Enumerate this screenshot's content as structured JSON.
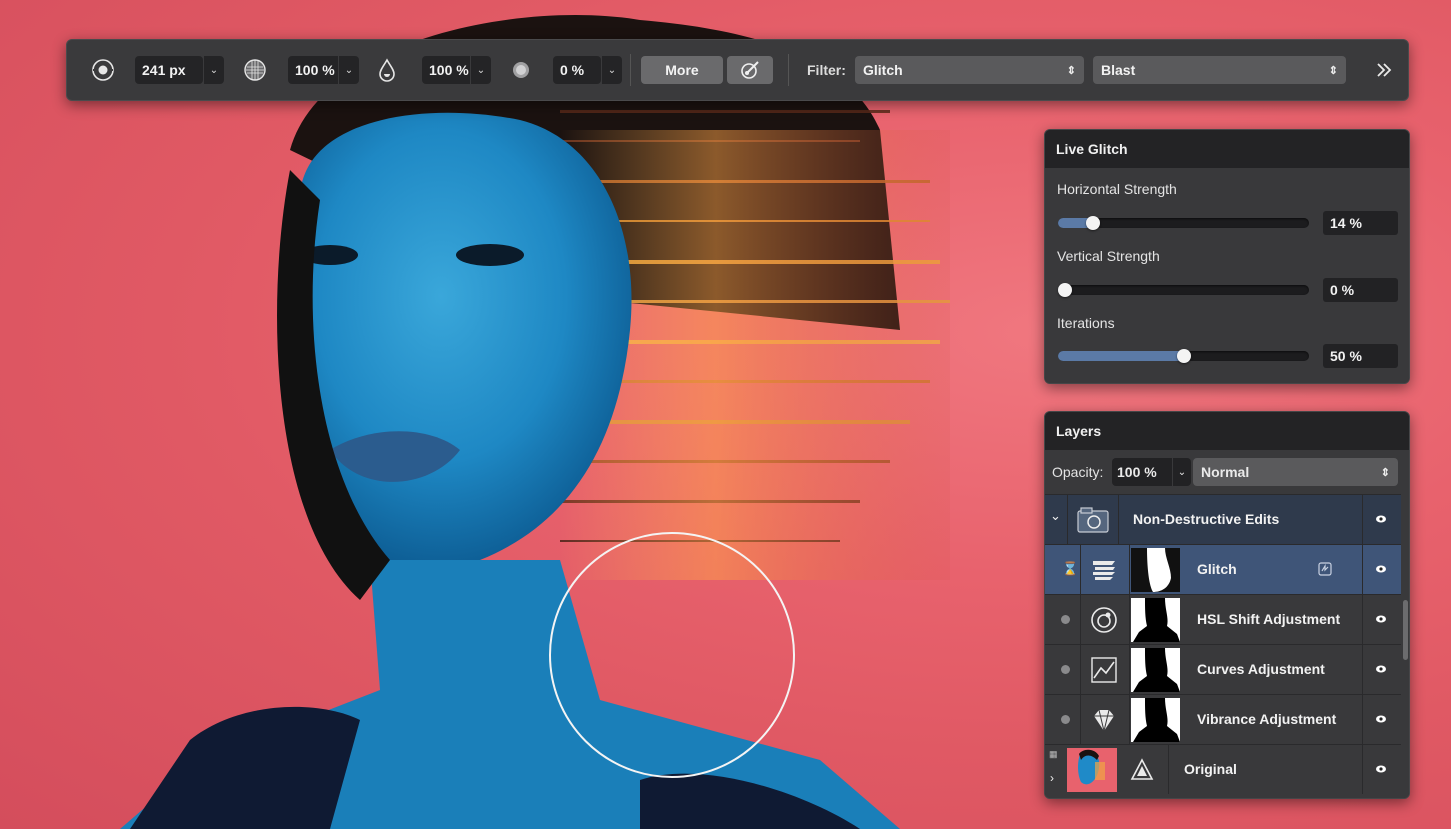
{
  "toolbar": {
    "width_value": "241 px",
    "hardness_value": "100 %",
    "flow_value": "100 %",
    "shape_value": "0 %",
    "more_label": "More",
    "filter_label": "Filter:",
    "filter_value": "Glitch",
    "filter_type_value": "Blast",
    "icons": [
      "brush-target-icon",
      "hardness-icon",
      "flow-drop-icon",
      "shape-dot-icon",
      "brush-settings-icon",
      "overflow-chevron-icon"
    ]
  },
  "live_glitch": {
    "title": "Live Glitch",
    "sliders": [
      {
        "label": "Horizontal Strength",
        "value_text": "14 %",
        "value": 0.14
      },
      {
        "label": "Vertical Strength",
        "value_text": "0 %",
        "value": 0.0
      },
      {
        "label": "Iterations",
        "value_text": "50 %",
        "value": 0.5
      }
    ]
  },
  "layers": {
    "title": "Layers",
    "opacity_label": "Opacity:",
    "opacity_value": "100 %",
    "blend_mode": "Normal",
    "group_name": "Non-Destructive Edits",
    "items": [
      {
        "name": "Glitch",
        "icon": "glitch-filter-icon",
        "selected": true
      },
      {
        "name": "HSL Shift Adjustment",
        "icon": "hsl-icon"
      },
      {
        "name": "Curves Adjustment",
        "icon": "curves-icon"
      },
      {
        "name": "Vibrance Adjustment",
        "icon": "vibrance-diamond-icon"
      }
    ],
    "base_layer": "Original"
  },
  "colors": {
    "background_red": "#e8626d",
    "panel_bg": "#39393b",
    "header_bg": "#232325",
    "selection_blue": "#3f5578",
    "slider_fill": "#5b7aa6"
  }
}
